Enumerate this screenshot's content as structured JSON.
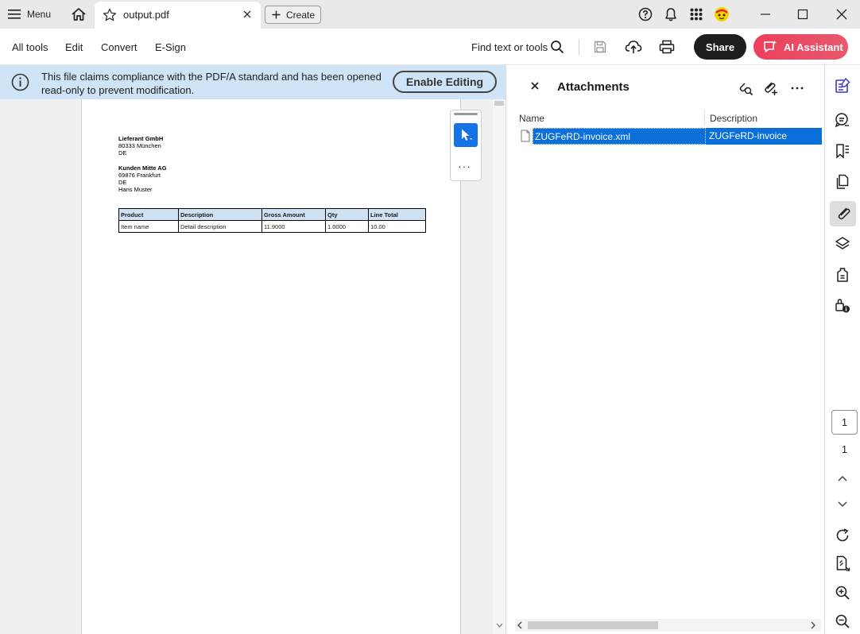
{
  "tabbar": {
    "menu_label": "Menu",
    "tab_title": "output.pdf",
    "create_label": "Create"
  },
  "toolbar": {
    "menu_items": [
      "All tools",
      "Edit",
      "Convert",
      "E-Sign"
    ],
    "find_label": "Find text or tools",
    "share_label": "Share",
    "ai_label": "AI Assistant"
  },
  "infobar": {
    "message": "This file claims compliance with the PDF/A standard and has been opened read-only to prevent modification.",
    "enable_label": "Enable Editing"
  },
  "document": {
    "seller": {
      "name": "Lieferant GmbH",
      "lines": [
        "80333 München",
        "DE"
      ]
    },
    "buyer": {
      "name": "Kunden Mitte AG",
      "lines": [
        "69876 Frankfurt",
        "DE",
        "Hans Muster"
      ]
    },
    "table": {
      "headers": [
        "Product",
        "Description",
        "Gross Amount",
        "Qty",
        "Line Total"
      ],
      "rows": [
        [
          "Item name",
          "Detail description",
          "11.9000",
          "1.0000",
          "10.00"
        ]
      ]
    }
  },
  "attachments": {
    "title": "Attachments",
    "columns": [
      "Name",
      "Description"
    ],
    "files": [
      {
        "name": "ZUGFeRD-invoice.xml",
        "description": "ZUGFeRD-invoice"
      }
    ]
  },
  "rail": {
    "current_page": "1",
    "total_pages": "1",
    "icons": [
      "edit-pdf-icon",
      "comment-icon",
      "bookmark-icon",
      "pages-icon",
      "attachment-icon",
      "layers-icon",
      "tag-icon",
      "accessibility-icon",
      "rotate-icon",
      "page-fit-icon",
      "zoom-in-icon",
      "zoom-out-icon"
    ]
  },
  "colors": {
    "accent": "#1473e6",
    "selection": "#0a6fd9",
    "infobar": "#cfe5f7",
    "ai_gradient_start": "#ec3f5c"
  }
}
